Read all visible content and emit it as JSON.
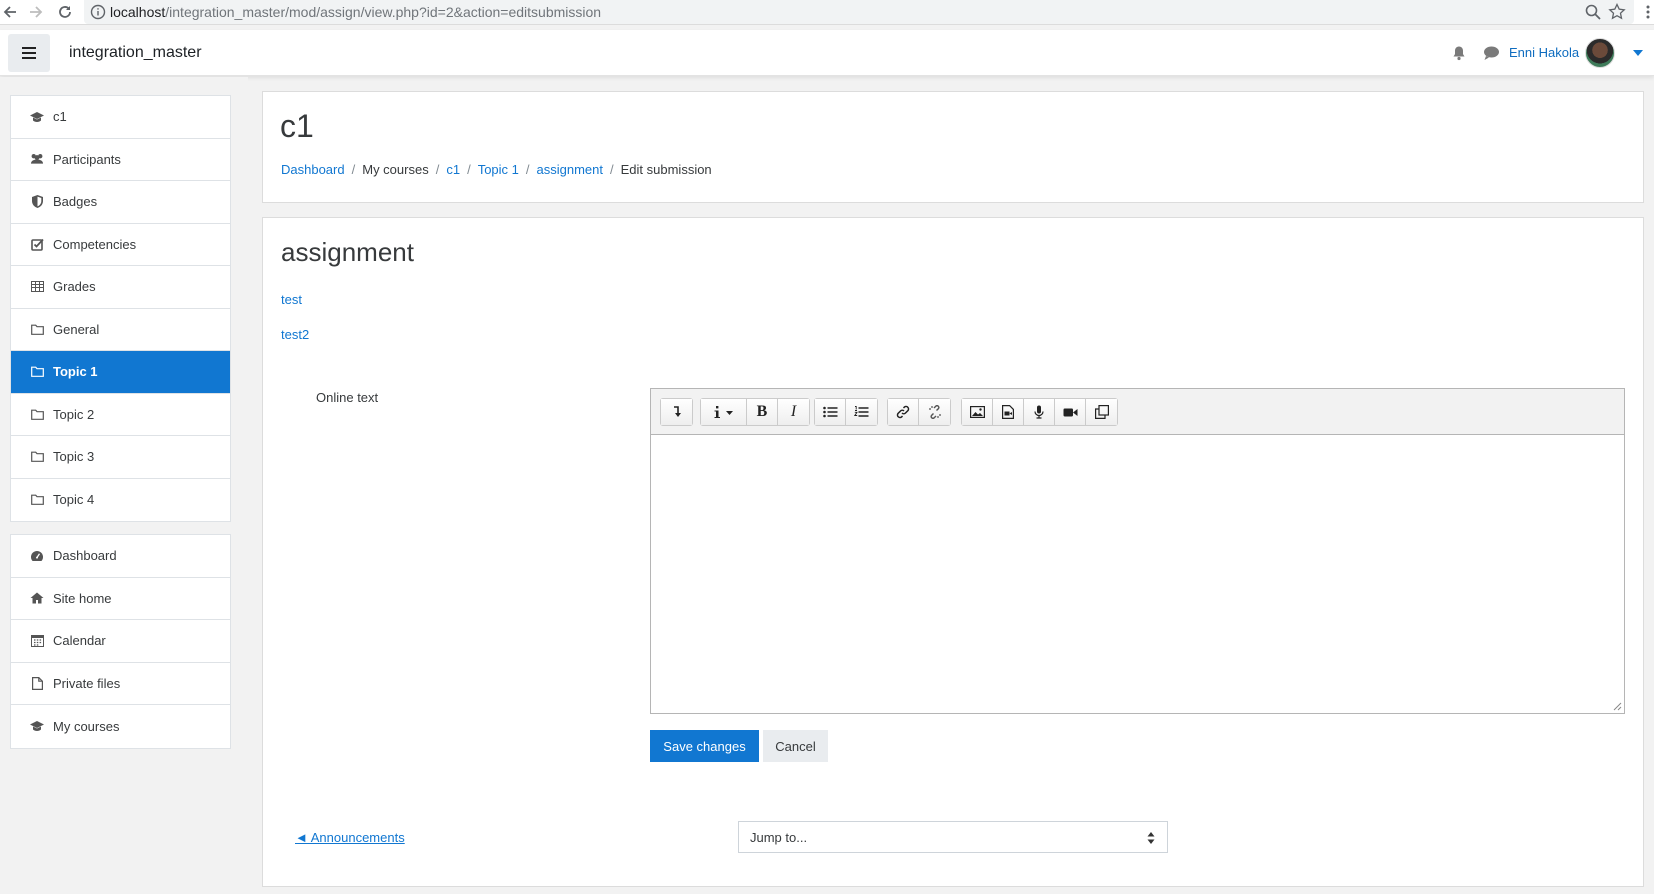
{
  "browser": {
    "url_host": "localhost",
    "url_path": "/integration_master/mod/assign/view.php?id=2&action=editsubmission"
  },
  "navbar": {
    "site_name": "integration_master",
    "user_name": "Enni Hakola"
  },
  "sidebar": {
    "course_items": [
      {
        "label": "c1",
        "icon": "graduation-cap-icon"
      },
      {
        "label": "Participants",
        "icon": "users-icon"
      },
      {
        "label": "Badges",
        "icon": "shield-icon"
      },
      {
        "label": "Competencies",
        "icon": "check-square-icon"
      },
      {
        "label": "Grades",
        "icon": "table-icon"
      },
      {
        "label": "General",
        "icon": "folder-icon"
      },
      {
        "label": "Topic 1",
        "icon": "folder-icon",
        "active": true
      },
      {
        "label": "Topic 2",
        "icon": "folder-icon"
      },
      {
        "label": "Topic 3",
        "icon": "folder-icon"
      },
      {
        "label": "Topic 4",
        "icon": "folder-icon"
      }
    ],
    "site_items": [
      {
        "label": "Dashboard",
        "icon": "dashboard-icon"
      },
      {
        "label": "Site home",
        "icon": "home-icon"
      },
      {
        "label": "Calendar",
        "icon": "calendar-icon"
      },
      {
        "label": "Private files",
        "icon": "file-icon"
      },
      {
        "label": "My courses",
        "icon": "graduation-cap-icon"
      }
    ]
  },
  "header": {
    "course_title": "c1",
    "breadcrumb": {
      "dashboard": "Dashboard",
      "my_courses": "My courses",
      "course": "c1",
      "topic": "Topic 1",
      "assignment": "assignment",
      "current": "Edit submission"
    }
  },
  "main": {
    "title": "assignment",
    "files": [
      "test",
      "test2"
    ],
    "online_text_label": "Online text",
    "editor_value": "",
    "save_label": "Save changes",
    "cancel_label": "Cancel",
    "prev_activity": "◄ Announcements",
    "jump_to": "Jump to..."
  },
  "colors": {
    "accent": "#1177d1",
    "background": "#f2f2f2"
  }
}
